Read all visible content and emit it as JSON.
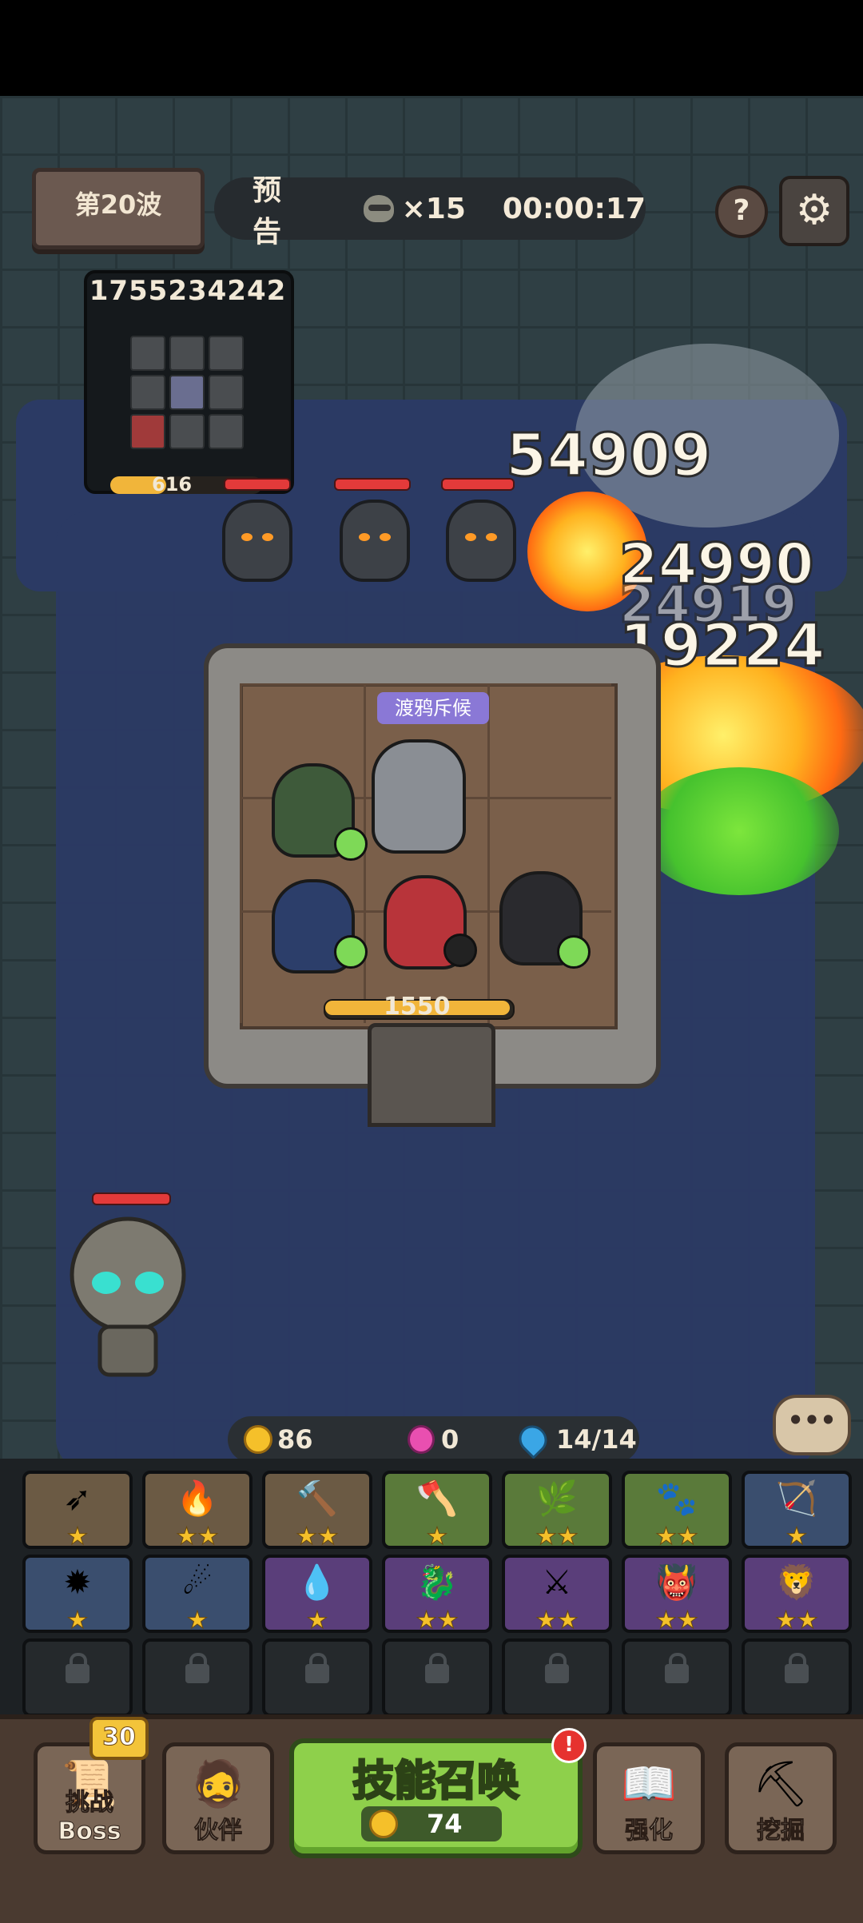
{
  "hud": {
    "wave_label": "第20波",
    "forecast_label": "预告",
    "enemy_count": "×15",
    "timer": "00:00:17",
    "help_label": "?",
    "settings_icon": "gear-icon"
  },
  "minimap": {
    "score": "1755234242",
    "hp_value": "616",
    "hp_fraction": 0.37
  },
  "battle": {
    "fortress_hp": "1550",
    "fortress_hp_fraction": 1.0,
    "hero_banner": "渡鸦斥候",
    "damage_numbers": [
      "54909",
      "24990",
      "24919",
      "19224"
    ]
  },
  "resources": {
    "gold": "86",
    "gems": "0",
    "energy": "14/14"
  },
  "skills": {
    "row1": [
      {
        "icon": "spear-icon",
        "stars": "★",
        "bg": "#6b5a44"
      },
      {
        "icon": "flame-icon",
        "stars": "★★",
        "bg": "#6b5a44"
      },
      {
        "icon": "hammer-icon",
        "stars": "★★",
        "bg": "#6b5a44"
      },
      {
        "icon": "axe-icon",
        "stars": "★",
        "bg": "#5a7a3a"
      },
      {
        "icon": "vine-icon",
        "stars": "★★",
        "bg": "#5a7a3a"
      },
      {
        "icon": "fire-claw-icon",
        "stars": "★★",
        "bg": "#5a7a3a"
      },
      {
        "icon": "crossbow-icon",
        "stars": "★",
        "bg": "#3a4e6e"
      }
    ],
    "row2": [
      {
        "icon": "spike-icon",
        "stars": "★",
        "bg": "#3a4e6e"
      },
      {
        "icon": "comet-icon",
        "stars": "★",
        "bg": "#3a4e6e"
      },
      {
        "icon": "water-icon",
        "stars": "★",
        "bg": "#5a3e7a"
      },
      {
        "icon": "dragon-icon",
        "stars": "★★",
        "bg": "#5a3e7a"
      },
      {
        "icon": "blades-icon",
        "stars": "★★",
        "bg": "#5a3e7a"
      },
      {
        "icon": "demon-icon",
        "stars": "★★",
        "bg": "#5a3e7a"
      },
      {
        "icon": "beast-icon",
        "stars": "★★",
        "bg": "#5a3e7a"
      }
    ]
  },
  "bottom_nav": {
    "challenge_boss": "挑战Boss",
    "challenge_badge": "30",
    "partner": "伙伴",
    "summon_label": "技能召唤",
    "summon_cost": "74",
    "summon_alert": "!",
    "upgrade": "强化",
    "dig": "挖掘"
  },
  "colors": {
    "accent_green": "#8ed04b",
    "gold": "#f5c02a",
    "enemy_hp": "#e33a3a"
  }
}
